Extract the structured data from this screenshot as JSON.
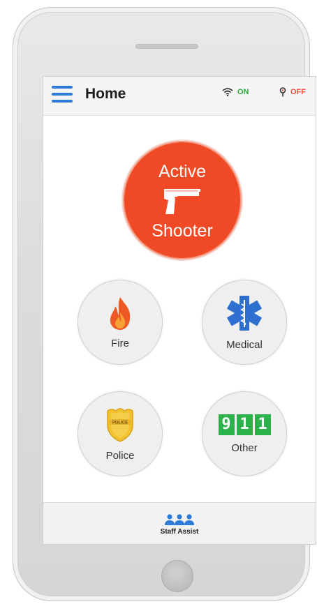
{
  "header": {
    "title": "Home",
    "wifi_status": "ON",
    "tracking_status": "OFF",
    "wifi_color": "#2eaa3a",
    "tracking_color": "#e5553a"
  },
  "active_shooter": {
    "line1": "Active",
    "line2": "Shooter",
    "icon": "pistol-icon",
    "color": "#ef4a25"
  },
  "alerts": [
    {
      "label": "Fire",
      "icon": "flame-icon"
    },
    {
      "label": "Medical",
      "icon": "star-of-life-icon"
    },
    {
      "label": "Police",
      "icon": "police-badge-icon",
      "badge_text": "POLICE"
    },
    {
      "label": "Other",
      "icon": "nine-one-one-icon",
      "digits": [
        "9",
        "1",
        "1"
      ]
    }
  ],
  "bottom_bar": {
    "label": "Staff Assist",
    "icon": "staff-group-icon"
  }
}
